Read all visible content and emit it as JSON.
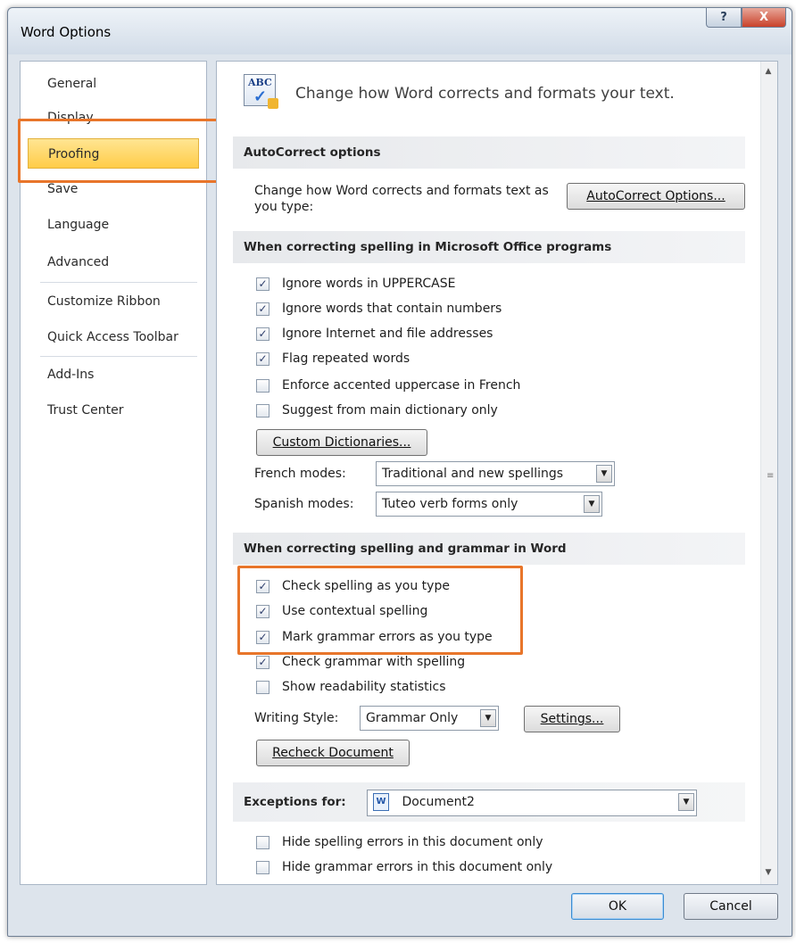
{
  "window": {
    "title": "Word Options",
    "help_label": "?",
    "close_label": "X"
  },
  "nav": {
    "items": [
      {
        "label": "General"
      },
      {
        "label": "Display"
      },
      {
        "label": "Proofing",
        "active": true
      },
      {
        "label": "Save"
      },
      {
        "label": "Language"
      },
      {
        "label": "Advanced"
      },
      {
        "label": "Customize Ribbon"
      },
      {
        "label": "Quick Access Toolbar"
      },
      {
        "label": "Add-Ins"
      },
      {
        "label": "Trust Center"
      }
    ]
  },
  "header": {
    "text": "Change how Word corrects and formats your text.",
    "icon_text": "ABC"
  },
  "autocorrect": {
    "heading": "AutoCorrect options",
    "description": "Change how Word corrects and formats text as you type:",
    "button": "AutoCorrect Options..."
  },
  "office_spelling": {
    "heading": "When correcting spelling in Microsoft Office programs",
    "options": [
      {
        "label": "Ignore words in UPPERCASE",
        "checked": true
      },
      {
        "label": "Ignore words that contain numbers",
        "checked": true
      },
      {
        "label": "Ignore Internet and file addresses",
        "checked": true
      },
      {
        "label": "Flag repeated words",
        "checked": true
      },
      {
        "label": "Enforce accented uppercase in French",
        "checked": false
      },
      {
        "label": "Suggest from main dictionary only",
        "checked": false
      }
    ],
    "custom_dictionaries_button": "Custom Dictionaries...",
    "french_modes_label": "French modes:",
    "french_modes_value": "Traditional and new spellings",
    "spanish_modes_label": "Spanish modes:",
    "spanish_modes_value": "Tuteo verb forms only"
  },
  "word_spelling": {
    "heading": "When correcting spelling and grammar in Word",
    "options": [
      {
        "label": "Check spelling as you type",
        "checked": true
      },
      {
        "label": "Use contextual spelling",
        "checked": true
      },
      {
        "label": "Mark grammar errors as you type",
        "checked": true
      },
      {
        "label": "Check grammar with spelling",
        "checked": true
      },
      {
        "label": "Show readability statistics",
        "checked": false
      }
    ],
    "writing_style_label": "Writing Style:",
    "writing_style_value": "Grammar Only",
    "settings_button": "Settings...",
    "recheck_button": "Recheck Document"
  },
  "exceptions": {
    "label": "Exceptions for:",
    "document_value": "Document2",
    "options": [
      {
        "label": "Hide spelling errors in this document only",
        "checked": false
      },
      {
        "label": "Hide grammar errors in this document only",
        "checked": false
      }
    ]
  },
  "footer": {
    "ok_label": "OK",
    "cancel_label": "Cancel"
  },
  "colors": {
    "highlight": "#e8752a",
    "active_nav": "#ffd35c"
  },
  "icons": [
    "help-icon",
    "close-icon",
    "abc-proofing-icon",
    "dropdown-arrow-icon",
    "document-icon",
    "checkbox-icon"
  ]
}
